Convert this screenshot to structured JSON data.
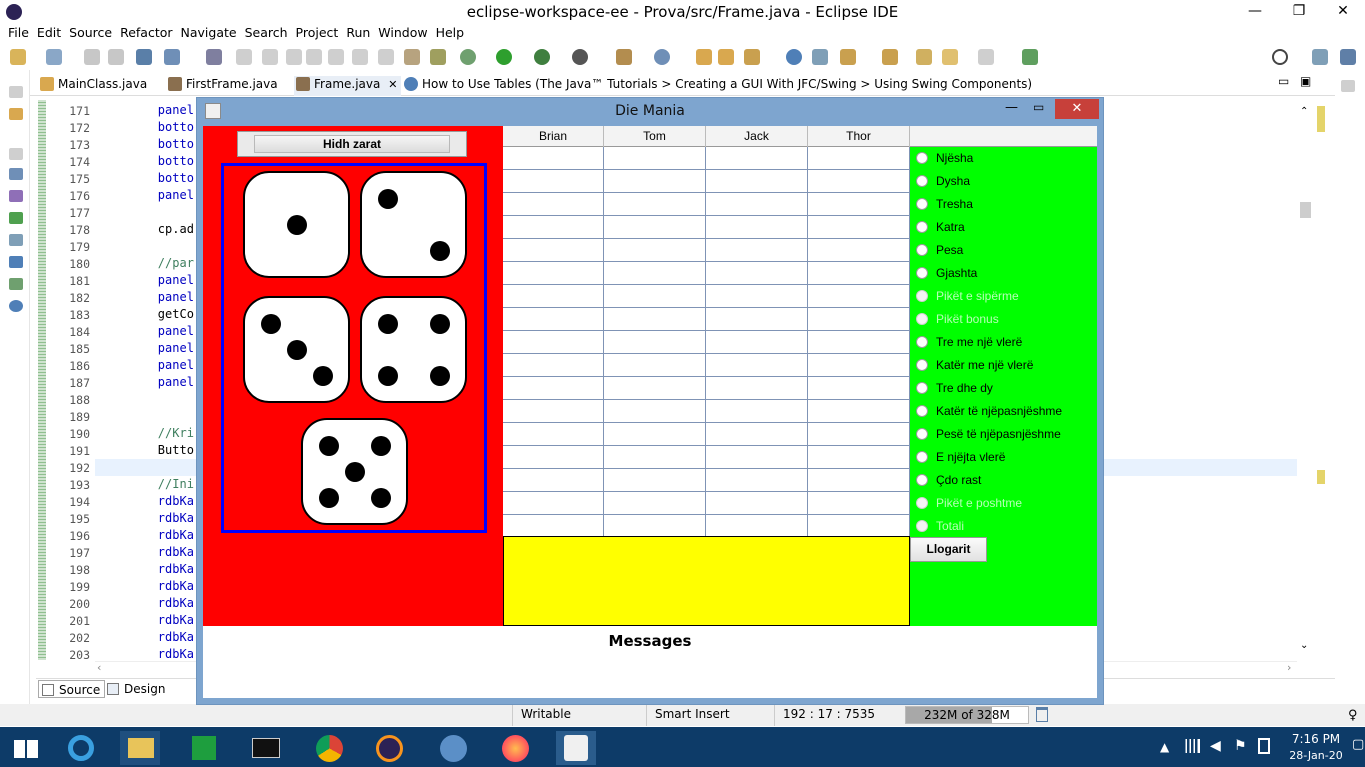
{
  "window": {
    "title": "eclipse-workspace-ee - Prova/src/Frame.java - Eclipse IDE"
  },
  "menu": [
    "File",
    "Edit",
    "Source",
    "Refactor",
    "Navigate",
    "Search",
    "Project",
    "Run",
    "Window",
    "Help"
  ],
  "editor_tabs": [
    {
      "label": "MainClass.java"
    },
    {
      "label": "FirstFrame.java"
    },
    {
      "label": "Frame.java",
      "close": "✕"
    },
    {
      "label": "How to Use Tables (The Java™ Tutorials > Creating a GUI With JFC/Swing > Using Swing Components)"
    }
  ],
  "code_lines": [
    {
      "n": "171",
      "t": "        panel"
    },
    {
      "n": "172",
      "t": "        botto"
    },
    {
      "n": "173",
      "t": "        botto"
    },
    {
      "n": "174",
      "t": "        botto"
    },
    {
      "n": "175",
      "t": "        botto"
    },
    {
      "n": "176",
      "t": "        panel"
    },
    {
      "n": "177",
      "t": ""
    },
    {
      "n": "178",
      "t": "        cp.ad"
    },
    {
      "n": "179",
      "t": ""
    },
    {
      "n": "180",
      "t": "        //par"
    },
    {
      "n": "181",
      "t": "        panel"
    },
    {
      "n": "182",
      "t": "        panel"
    },
    {
      "n": "183",
      "t": "        getCo"
    },
    {
      "n": "184",
      "t": "        panel"
    },
    {
      "n": "185",
      "t": "        panel"
    },
    {
      "n": "186",
      "t": "        panel"
    },
    {
      "n": "187",
      "t": "        panel"
    },
    {
      "n": "188",
      "t": ""
    },
    {
      "n": "189",
      "t": ""
    },
    {
      "n": "190",
      "t": "        //Kri"
    },
    {
      "n": "191",
      "t": "        Butto"
    },
    {
      "n": "192",
      "t": ""
    },
    {
      "n": "193",
      "t": "        //Ini"
    },
    {
      "n": "194",
      "t": "        rdbKa"
    },
    {
      "n": "195",
      "t": "        rdbKa"
    },
    {
      "n": "196",
      "t": "        rdbKa"
    },
    {
      "n": "197",
      "t": "        rdbKa"
    },
    {
      "n": "198",
      "t": "        rdbKa"
    },
    {
      "n": "199",
      "t": "        rdbKa"
    },
    {
      "n": "200",
      "t": "        rdbKa"
    },
    {
      "n": "201",
      "t": "        rdbKa"
    },
    {
      "n": "202",
      "t": "        rdbKa"
    },
    {
      "n": "203",
      "t": "        rdbKa"
    }
  ],
  "bottom_tabs": {
    "source": "Source",
    "design": "Design"
  },
  "status": {
    "writable": "Writable",
    "insert": "Smart Insert",
    "position": "192 : 17 : 7535",
    "memory": "232M of 328M",
    "memory_used_fraction": 0.707
  },
  "app": {
    "title": "Die Mania",
    "roll_button": "Hidh zarat",
    "dice_values": [
      1,
      2,
      3,
      4,
      5
    ],
    "players": [
      "Brian",
      "Tom",
      "Jack",
      "Thor"
    ],
    "row_count": 17,
    "categories": [
      {
        "label": "Një​sha",
        "enabled": true
      },
      {
        "label": "Dysha",
        "enabled": true
      },
      {
        "label": "Tresha",
        "enabled": true
      },
      {
        "label": "Katra",
        "enabled": true
      },
      {
        "label": "Pesa",
        "enabled": true
      },
      {
        "label": "Gjashta",
        "enabled": true
      },
      {
        "label": "Pikët e sipërme",
        "enabled": false
      },
      {
        "label": "Pikët bonus",
        "enabled": false
      },
      {
        "label": "Tre me një vlerë",
        "enabled": true
      },
      {
        "label": "Katër me një vlerë",
        "enabled": true
      },
      {
        "label": "Tre dhe dy",
        "enabled": true
      },
      {
        "label": "Katër të njëpasnjëshme",
        "enabled": true
      },
      {
        "label": "Pesë të njëpasnjëshme",
        "enabled": true
      },
      {
        "label": "E njëjta vlerë",
        "enabled": true
      },
      {
        "label": "Çdo rast",
        "enabled": true
      },
      {
        "label": "Pikët e poshtme",
        "enabled": false
      },
      {
        "label": "Totali",
        "enabled": false
      }
    ],
    "calc_button": "Llogarit",
    "messages_label": "Messages"
  },
  "taskbar": {
    "time": "7:16 PM",
    "date": "28-Jan-20"
  },
  "colors": {
    "red_panel": "#ff0000",
    "green_panel": "#00ff00",
    "yellow_panel": "#ffff00",
    "dice_border": "#0000ff",
    "taskbar": "#0d3b68"
  }
}
